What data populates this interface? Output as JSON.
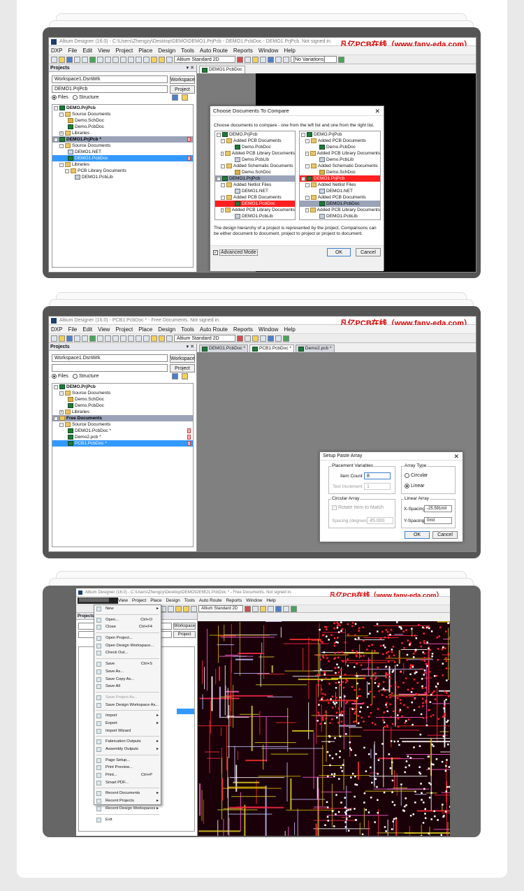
{
  "brand": "凡亿PCB在线（www.fany-eda.com）",
  "s1": {
    "title": "Altium Designer (16.0) - C:\\Users\\Zhengzy\\Desktop\\DEMO\\DEMO1.PrjPcb - DEMO1.PcbDoc - DEMO1.PrjPcb. Not signed in.",
    "menus": [
      "DXP",
      "File",
      "Edit",
      "View",
      "Project",
      "Place",
      "Design",
      "Tools",
      "Auto Route",
      "Reports",
      "Window",
      "Help"
    ],
    "view_mode": "Altium Standard 2D",
    "variations": "[No Variations]",
    "panel_title": "Projects",
    "workspace_value": "Workspace1.DsnWrk",
    "workspace_btn": "Workspace",
    "project_value": "DEMO1.PrjPcb",
    "project_btn": "Project",
    "radio_files": "Files",
    "radio_structure": "Structure",
    "tree": [
      "DEMO.PrjPcb",
      "Source Documents",
      "Demo.SchDoc",
      "Demo.PcbDoc",
      "Libraries",
      "DEMO1.PrjPcb *",
      "Source Documents",
      "DEMO1.NET",
      "DEMO1.PcbDoc",
      "Libraries",
      "PCB Library Documents",
      "DEMO1.PcbLib"
    ],
    "doctab": "DEMO1.PcbDoc",
    "dialog": {
      "title": "Choose Documents To Compare",
      "instruction": "Choose documents to compare - one from the left list and one from the right list.",
      "left": [
        "DEMO.PrjPcb",
        "Added PCB Documents",
        "Demo.PcbDoc",
        "Added PCB Library Documents",
        "Demo.PcbLib",
        "Added Schematic Documents",
        "Demo.SchDoc",
        "DEMO1.PrjPcb",
        "Added Netlist Files",
        "DEMO1.NET",
        "Added PCB Documents",
        "DEMO1.PcbDoc",
        "Added PCB Library Documents",
        "DEMO1.PcbLib"
      ],
      "right": [
        "DEMO.PrjPcb",
        "Added PCB Documents",
        "Demo.PcbDoc",
        "Added PCB Library Documents",
        "Demo.PcbLib",
        "Added Schematic Documents",
        "Demo.SchDoc",
        "DEMO1.PrjPcb",
        "Added Netlist Files",
        "DEMO1.NET",
        "Added PCB Documents",
        "DEMO1.PcbDoc",
        "Added PCB Library Documents",
        "DEMO1.PcbLib"
      ],
      "note": "The design hierarchy of a project is represented by the project. Comparisons can be either document to document, project to project or project to document.",
      "advanced": "Advanced Mode",
      "ok": "OK",
      "cancel": "Cancel"
    }
  },
  "s2": {
    "title": "Altium Designer (16.0) - PCB1.PcbDoc * - Free Documents. Not signed in.",
    "menus": [
      "DXP",
      "File",
      "Edit",
      "View",
      "Project",
      "Place",
      "Design",
      "Tools",
      "Auto Route",
      "Reports",
      "Window",
      "Help"
    ],
    "view_mode": "Altium Standard 2D",
    "panel_title": "Projects",
    "workspace_value": "Workspace1.DsnWrk",
    "workspace_btn": "Workspace",
    "project_btn": "Project",
    "radio_files": "Files",
    "radio_structure": "Structure",
    "tree": [
      "DEMO.PrjPcb",
      "Source Documents",
      "Demo.SchDoc",
      "Demo.PcbDoc",
      "Libraries",
      "Free Documents",
      "Source Documents",
      "DEMO1.PcbDoc *",
      "Demo2.pcb *",
      "PCB1.PcbDoc *"
    ],
    "doctabs": [
      "DEMO1.PcbDoc *",
      "PCB1.PcbDoc *",
      "Demo2.pcb *"
    ],
    "dialog": {
      "title": "Setup Paste Array",
      "placement": "Placement Variables",
      "item_count_label": "Item Count",
      "item_count": "8",
      "text_inc_label": "Text Increment",
      "text_inc": "1",
      "array_type": "Array Type",
      "circular": "Circular",
      "linear": "Linear",
      "circular_array": "Circular Array",
      "rotate": "Rotate Item to Match",
      "spacing_label": "Spacing (degrees)",
      "spacing": "45.000",
      "linear_array": "Linear Array",
      "xs_label": "X-Spacing",
      "xs": "-25.591mil",
      "ys_label": "Y-Spacing",
      "ys": "0mil",
      "ok": "OK",
      "cancel": "Cancel"
    }
  },
  "s3": {
    "title": "Altium Designer (16.0) - C:\\Users\\Zhengzy\\Desktop\\DEMO\\DEMO1.PcbDoc * - Free Documents. Not signed in.",
    "menus": [
      "View",
      "Project",
      "Place",
      "Design",
      "Tools",
      "Auto Route",
      "Reports",
      "Window",
      "Help"
    ],
    "view_mode": "Altium Standard 2D",
    "panel_title": "Projects",
    "workspace_btn": "Workspace",
    "project_btn": "Project",
    "menu": [
      {
        "label": "New",
        "sc": "",
        "ar": "▸"
      },
      {
        "sep": true
      },
      {
        "label": "Open...",
        "sc": "Ctrl+O"
      },
      {
        "label": "Close",
        "sc": "Ctrl+F4"
      },
      {
        "sep": true
      },
      {
        "label": "Open Project..."
      },
      {
        "label": "Open Design Workspace..."
      },
      {
        "label": "Check Out..."
      },
      {
        "sep": true
      },
      {
        "label": "Save",
        "sc": "Ctrl+S"
      },
      {
        "label": "Save As..."
      },
      {
        "label": "Save Copy As..."
      },
      {
        "label": "Save All"
      },
      {
        "sep": true
      },
      {
        "label": "Save Project As...",
        "dis": true
      },
      {
        "label": "Save Design Workspace As..."
      },
      {
        "sep": true
      },
      {
        "label": "Import",
        "ar": "▸"
      },
      {
        "label": "Export",
        "ar": "▸"
      },
      {
        "label": "Import Wizard"
      },
      {
        "sep": true
      },
      {
        "label": "Fabrication Outputs",
        "ar": "▸"
      },
      {
        "label": "Assembly Outputs",
        "ar": "▸"
      },
      {
        "sep": true
      },
      {
        "label": "Page Setup..."
      },
      {
        "label": "Print Preview..."
      },
      {
        "label": "Print...",
        "sc": "Ctrl+P"
      },
      {
        "label": "Smart PDF..."
      },
      {
        "sep": true
      },
      {
        "label": "Recent Documents",
        "ar": "▸"
      },
      {
        "label": "Recent Projects",
        "ar": "▸"
      },
      {
        "label": "Recent Design Workspaces",
        "ar": "▸"
      },
      {
        "sep": true
      },
      {
        "label": "Exit"
      }
    ]
  },
  "colors": {
    "brand_red": "#d40000",
    "select_blue": "#3399ff",
    "canvas_black": "#000000",
    "card_grey": "#555555"
  }
}
